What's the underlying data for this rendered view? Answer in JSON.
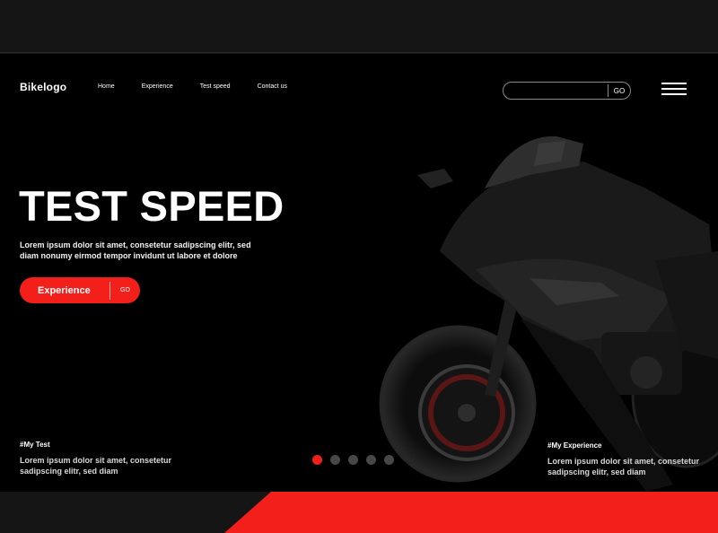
{
  "header": {
    "logo": "Bikelogo",
    "nav": [
      {
        "label": "Home"
      },
      {
        "label": "Experience"
      },
      {
        "label": "Test speed"
      },
      {
        "label": "Contact us"
      }
    ],
    "search": {
      "placeholder": "",
      "button": "GO"
    }
  },
  "hero": {
    "title": "TEST SPEED",
    "description": "Lorem ipsum dolor sit amet, consetetur sadipscing elitr, sed diam nonumy eirmod tempor invidunt ut labore et dolore",
    "cta": {
      "label": "Experience",
      "go": "GO"
    }
  },
  "info_left": {
    "tag": "#My Test",
    "text": "Lorem ipsum dolor sit amet, consetetur sadipscing elitr, sed diam"
  },
  "info_right": {
    "tag": "#My Experience",
    "text": "Lorem ipsum dolor sit amet, consetetur sadipscing elitr, sed diam"
  },
  "slider": {
    "count": 5,
    "active": 1
  },
  "colors": {
    "accent": "#f31f1b",
    "background": "#000000",
    "band": "#151515"
  }
}
